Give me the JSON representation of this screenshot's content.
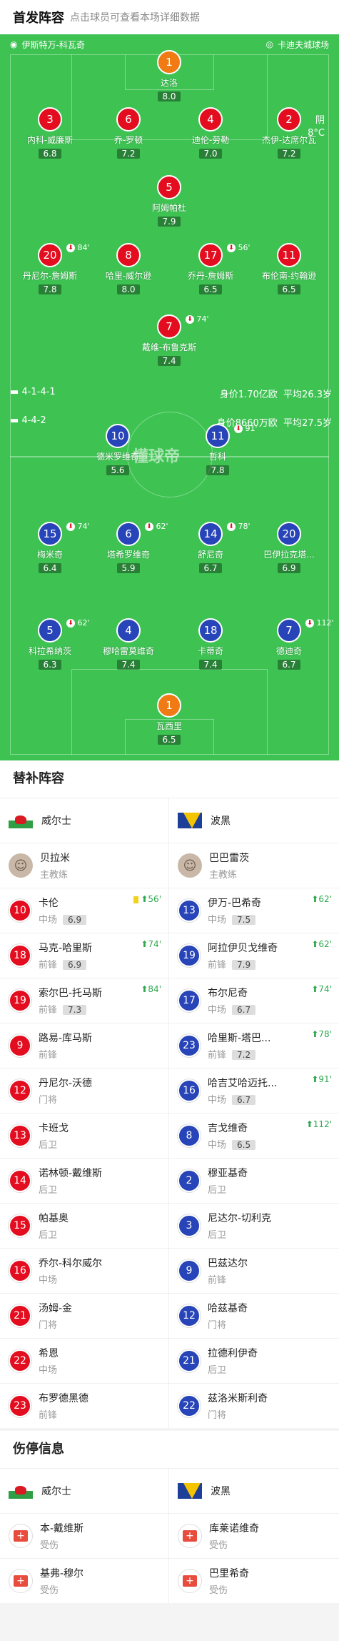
{
  "header": {
    "title": "首发阵容",
    "subtitle": "点击球员可查看本场详细数据"
  },
  "pitch": {
    "home_team": "伊斯特万-科瓦奇",
    "away_team": "卡迪夫城球场",
    "weather": "阴",
    "temp": "8°C",
    "watermark": "懂球帝",
    "home_form": "4-1-4-1",
    "home_value": "身价1.70亿欧",
    "home_age": "平均26.3岁",
    "away_form": "4-4-2",
    "away_value": "身价8660万欧",
    "away_age": "平均27.5岁"
  },
  "home_players": [
    {
      "num": "1",
      "name": "达洛",
      "rating": "8.0",
      "ev": ""
    },
    {
      "num": "3",
      "name": "内科-威廉斯",
      "rating": "6.8",
      "ev": ""
    },
    {
      "num": "6",
      "name": "乔-罗顿",
      "rating": "7.2",
      "ev": ""
    },
    {
      "num": "4",
      "name": "迪伦-劳勒",
      "rating": "7.0",
      "ev": ""
    },
    {
      "num": "2",
      "name": "杰伊-达席尔瓦",
      "rating": "7.2",
      "ev": ""
    },
    {
      "num": "5",
      "name": "阿姆帕杜",
      "rating": "7.9",
      "ev": ""
    },
    {
      "num": "20",
      "name": "丹尼尔-詹姆斯",
      "rating": "7.8",
      "ev": "84'"
    },
    {
      "num": "8",
      "name": "哈里-威尔逊",
      "rating": "8.0",
      "ev": ""
    },
    {
      "num": "17",
      "name": "乔丹-詹姆斯",
      "rating": "6.5",
      "ev": "56'"
    },
    {
      "num": "11",
      "name": "布伦南-约翰逊",
      "rating": "6.5",
      "ev": ""
    },
    {
      "num": "7",
      "name": "戴维-布鲁克斯",
      "rating": "7.4",
      "ev": "74'"
    }
  ],
  "away_players": [
    {
      "num": "10",
      "name": "德米罗维奇",
      "rating": "5.6",
      "ev": ""
    },
    {
      "num": "11",
      "name": "哲科",
      "rating": "7.8",
      "ev": "91'"
    },
    {
      "num": "15",
      "name": "梅米奇",
      "rating": "6.4",
      "ev": "74'"
    },
    {
      "num": "6",
      "name": "塔希罗维奇",
      "rating": "5.9",
      "ev": "62'"
    },
    {
      "num": "14",
      "name": "舒尼奇",
      "rating": "6.7",
      "ev": "78'"
    },
    {
      "num": "20",
      "name": "巴伊拉克塔...",
      "rating": "6.9",
      "ev": ""
    },
    {
      "num": "5",
      "name": "科拉希纳茨",
      "rating": "6.3",
      "ev": "62'"
    },
    {
      "num": "4",
      "name": "穆哈雷莫维奇",
      "rating": "7.4",
      "ev": ""
    },
    {
      "num": "18",
      "name": "卡蒂奇",
      "rating": "7.4",
      "ev": ""
    },
    {
      "num": "7",
      "name": "德迪奇",
      "rating": "6.7",
      "ev": "112'"
    },
    {
      "num": "1",
      "name": "瓦西里",
      "rating": "6.5",
      "ev": ""
    }
  ],
  "subs": {
    "title": "替补阵容",
    "home_team": "威尔士",
    "away_team": "波黑",
    "home_coach": {
      "name": "贝拉米",
      "role": "主教练"
    },
    "away_coach": {
      "name": "巴巴雷茨",
      "role": "主教练"
    },
    "home": [
      {
        "num": "10",
        "name": "卡伦",
        "pos": "中场",
        "rating": "6.9",
        "ev": "56'"
      },
      {
        "num": "18",
        "name": "马克-哈里斯",
        "pos": "前锋",
        "rating": "6.9",
        "ev": "74'"
      },
      {
        "num": "19",
        "name": "索尔巴-托马斯",
        "pos": "前锋",
        "rating": "7.3",
        "ev": "84'"
      },
      {
        "num": "9",
        "name": "路易-库马斯",
        "pos": "前锋",
        "rating": "",
        "ev": ""
      },
      {
        "num": "12",
        "name": "丹尼尔-沃德",
        "pos": "门将",
        "rating": "",
        "ev": ""
      },
      {
        "num": "13",
        "name": "卡班戈",
        "pos": "后卫",
        "rating": "",
        "ev": ""
      },
      {
        "num": "14",
        "name": "诺林顿-戴维斯",
        "pos": "后卫",
        "rating": "",
        "ev": ""
      },
      {
        "num": "15",
        "name": "帕基奥",
        "pos": "后卫",
        "rating": "",
        "ev": ""
      },
      {
        "num": "16",
        "name": "乔尔-科尔威尔",
        "pos": "中场",
        "rating": "",
        "ev": ""
      },
      {
        "num": "21",
        "name": "汤姆-金",
        "pos": "门将",
        "rating": "",
        "ev": ""
      },
      {
        "num": "22",
        "name": "希恩",
        "pos": "中场",
        "rating": "",
        "ev": ""
      },
      {
        "num": "23",
        "name": "布罗德黑德",
        "pos": "前锋",
        "rating": "",
        "ev": ""
      }
    ],
    "away": [
      {
        "num": "13",
        "name": "伊万-巴希奇",
        "pos": "中场",
        "rating": "7.5",
        "ev": "62'"
      },
      {
        "num": "19",
        "name": "阿拉伊贝戈维奇",
        "pos": "前锋",
        "rating": "7.9",
        "ev": "62'"
      },
      {
        "num": "17",
        "name": "布尔尼奇",
        "pos": "中场",
        "rating": "6.7",
        "ev": "74'"
      },
      {
        "num": "23",
        "name": "哈里斯-塔巴...",
        "pos": "前锋",
        "rating": "7.2",
        "ev": "78'"
      },
      {
        "num": "16",
        "name": "哈吉艾哈迈托...",
        "pos": "中场",
        "rating": "6.7",
        "ev": "91'"
      },
      {
        "num": "8",
        "name": "吉戈维奇",
        "pos": "中场",
        "rating": "6.5",
        "ev": "112'"
      },
      {
        "num": "2",
        "name": "穆亚基奇",
        "pos": "后卫",
        "rating": "",
        "ev": ""
      },
      {
        "num": "3",
        "name": "尼达尔-切利克",
        "pos": "后卫",
        "rating": "",
        "ev": ""
      },
      {
        "num": "9",
        "name": "巴兹达尔",
        "pos": "前锋",
        "rating": "",
        "ev": ""
      },
      {
        "num": "12",
        "name": "哈兹基奇",
        "pos": "门将",
        "rating": "",
        "ev": ""
      },
      {
        "num": "21",
        "name": "拉德利伊奇",
        "pos": "后卫",
        "rating": "",
        "ev": ""
      },
      {
        "num": "22",
        "name": "兹洛米斯利奇",
        "pos": "门将",
        "rating": "",
        "ev": ""
      }
    ]
  },
  "injuries": {
    "title": "伤停信息",
    "home_team": "威尔士",
    "away_team": "波黑",
    "home": [
      {
        "name": "本-戴维斯",
        "status": "受伤"
      },
      {
        "name": "基弗-穆尔",
        "status": "受伤"
      }
    ],
    "away": [
      {
        "name": "库莱诺维奇",
        "status": "受伤"
      },
      {
        "name": "巴里希奇",
        "status": "受伤"
      }
    ]
  },
  "colors": {
    "home": "#e30d1f",
    "away": "#2744b8",
    "gk": "#f07b14",
    "pitch": "#3ec353"
  }
}
